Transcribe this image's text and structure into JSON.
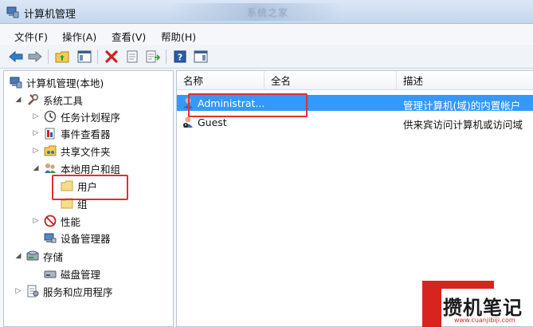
{
  "window": {
    "title": "计算机管理",
    "blurred_title": "系统之家"
  },
  "menu": [
    "文件(F)",
    "操作(A)",
    "查看(V)",
    "帮助(H)"
  ],
  "tree": {
    "root": "计算机管理(本地)",
    "system_tools": "系统工具",
    "task_scheduler": "任务计划程序",
    "event_viewer": "事件查看器",
    "shared_folders": "共享文件夹",
    "local_users_groups": "本地用户和组",
    "users": "用户",
    "groups": "组",
    "performance": "性能",
    "device_manager": "设备管理器",
    "storage": "存储",
    "disk_management": "磁盘管理",
    "services_apps": "服务和应用程序"
  },
  "list": {
    "headers": [
      "名称",
      "全名",
      "描述"
    ],
    "rows": [
      {
        "name": "Administrat...",
        "fullname": "",
        "desc": "管理计算机(域)的内置帐户",
        "selected": true
      },
      {
        "name": "Guest",
        "fullname": "",
        "desc": "供来宾访问计算机或访问域",
        "selected": false
      }
    ]
  },
  "watermark": {
    "text": "攒机笔记",
    "url": "www.cuanjibiji.com"
  },
  "colors": {
    "selection": "#3399ff",
    "highlight": "#e03030",
    "watermark_red": "#d8241e"
  }
}
